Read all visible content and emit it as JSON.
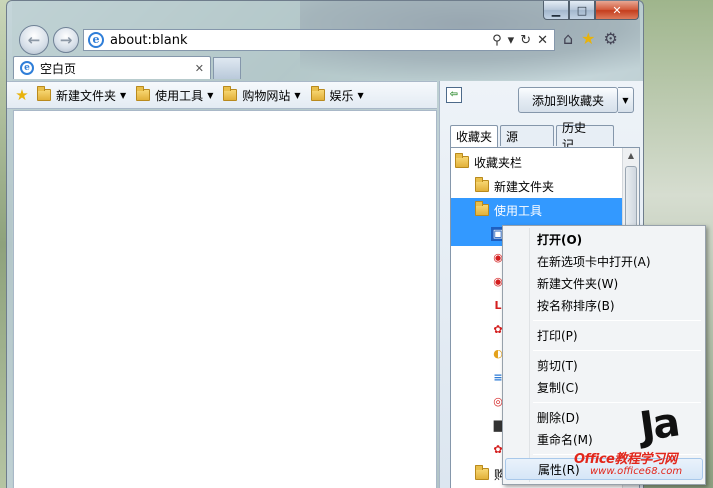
{
  "window": {
    "controls": {
      "minimize": "▁",
      "maximize": "□",
      "close": "✕"
    }
  },
  "nav": {
    "back_icon": "←",
    "forward_icon": "→",
    "address": "about:blank",
    "address_tools": {
      "search": "⚲",
      "dropdown": "▾",
      "refresh": "↻",
      "stop": "✕"
    },
    "icons": {
      "home": "⌂",
      "favorites": "★",
      "tools": "⚙"
    }
  },
  "tabs": [
    {
      "label": "空白页",
      "close": "✕"
    }
  ],
  "favbar": {
    "items": [
      {
        "label": "新建文件夹"
      },
      {
        "label": "使用工具"
      },
      {
        "label": "购物网站"
      },
      {
        "label": "娱乐"
      }
    ]
  },
  "panel": {
    "pin": "⇦",
    "add_label": "添加到收藏夹",
    "add_drop": "▼",
    "tabs": [
      "收藏夹",
      "源",
      "历史记..."
    ],
    "tree": [
      {
        "label": "收藏夹栏",
        "level": 0
      },
      {
        "label": "新建文件夹",
        "level": 1
      },
      {
        "label": "使用工具",
        "level": 1,
        "selected": true
      },
      {
        "label": "购",
        "level": 1
      }
    ],
    "site_icons": [
      "▣",
      "◉",
      "◉",
      "L",
      "✿",
      "◐",
      "≡",
      "◎",
      "▇",
      "✿"
    ]
  },
  "context_menu": {
    "items": [
      {
        "label": "打开(O)",
        "bold": true
      },
      {
        "label": "在新选项卡中打开(A)"
      },
      {
        "label": "新建文件夹(W)"
      },
      {
        "label": "按名称排序(B)"
      },
      {
        "label": "打印(P)"
      },
      {
        "label": "剪切(T)"
      },
      {
        "label": "复制(C)"
      },
      {
        "label": "删除(D)"
      },
      {
        "label": "重命名(M)"
      },
      {
        "label": "属性(R)"
      }
    ]
  },
  "watermark": {
    "big": "Ja",
    "line1": "Office教程学习网",
    "line2": "www.office68.com"
  },
  "colors": {
    "selection": "#3399ff",
    "watermark": "#e2261b",
    "favorites_star": "#e8b30c"
  }
}
